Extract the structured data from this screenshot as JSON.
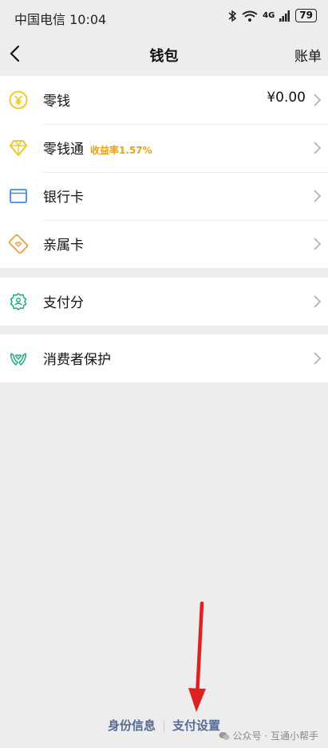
{
  "status_bar": {
    "carrier_time": "中国电信 10:04",
    "network": "4G",
    "battery": "79"
  },
  "nav": {
    "title": "钱包",
    "right_action": "账单"
  },
  "group1": [
    {
      "label": "零钱",
      "value": "¥0.00",
      "icon": "coin-icon"
    },
    {
      "label": "零钱通",
      "badge": "收益率1.57%",
      "icon": "diamond-icon"
    },
    {
      "label": "银行卡",
      "icon": "bank-card-icon"
    },
    {
      "label": "亲属卡",
      "icon": "family-card-icon"
    }
  ],
  "group2": [
    {
      "label": "支付分",
      "icon": "pay-score-icon"
    }
  ],
  "group3": [
    {
      "label": "消费者保护",
      "icon": "consumer-protection-icon"
    }
  ],
  "footer": {
    "identity": "身份信息",
    "pay_settings": "支付设置"
  },
  "watermark": "公众号 · 互通小帮手",
  "colors": {
    "background": "#ededed",
    "link": "#576b95",
    "badge": "#e8a317",
    "arrow": "#e02020"
  }
}
